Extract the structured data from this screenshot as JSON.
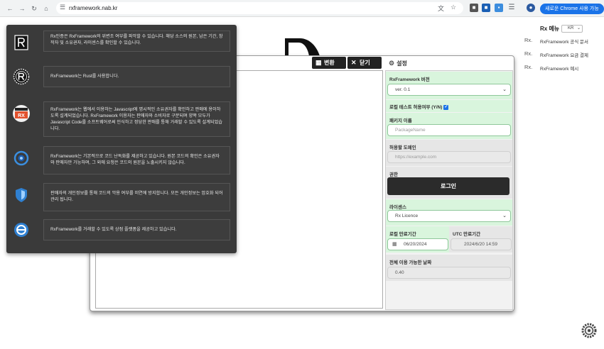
{
  "browser": {
    "url": "rxframework.nab.kr",
    "update_button": "새로운 Chrome 사용 가능",
    "nav_icons": [
      "back-arrow-icon",
      "forward-arrow-icon",
      "reload-icon",
      "home-icon"
    ]
  },
  "header": {
    "menu_title": "Rx 메뉴",
    "language": "KR",
    "links": [
      {
        "prefix": "Rx.",
        "label": "RxFramework 공식 문서"
      },
      {
        "prefix": "Rx.",
        "label": "RxFramework 요금 결제"
      },
      {
        "prefix": "Rx.",
        "label": "RxFramework 예시"
      }
    ]
  },
  "toolbar": {
    "convert_label": "변환",
    "close_label": "닫기",
    "settings_label": "설정"
  },
  "settings": {
    "version": {
      "label": "RxFramework 버전",
      "value": "ver. 0.1"
    },
    "local_test": {
      "label": "로컬 테스트 허용여부 (Y/N)",
      "checked": true
    },
    "package": {
      "label": "패키지 이름",
      "placeholder": "PackageName"
    },
    "domain": {
      "label": "허용할 도메인",
      "placeholder": "https://example.com"
    },
    "auth": {
      "label": "권한",
      "button": "로그인"
    },
    "license": {
      "label": "라이센스",
      "value": "Rx Licence"
    },
    "local_expire": {
      "label": "로컬 만료기간",
      "value": "06/20/2024"
    },
    "utc_expire": {
      "label": "UTC 만료기간",
      "value": "2024/6/20 14:59"
    },
    "days_left": {
      "label": "전체 이용 가능한 날짜",
      "value": "0.40"
    }
  },
  "overlay": {
    "items": [
      {
        "icon": "rx-logo-icon",
        "text": "Rx인증은 RxFramework의 위변조 여부를 파악할 수 있습니다. 해당 소스의 원본, 남은 기간, 창작자 및 소유권자, 라이센스를 확인할 수 있습니다."
      },
      {
        "icon": "rust-logo-icon",
        "text": "RxFramework는 Rust를 사용합니다."
      },
      {
        "icon": "rx-js-badge-icon",
        "text": "RxFramework는 웹에서 이용하는 Javascript에 명시적인 소유권자를 확인하고 판매에 용이하도록 설계되었습니다. RxFramework 이용자는 판매자와 소비자로 구분되며 양쪽 모두가 Javascript Code를 소프트웨어로써 인식하고 정당한 판매를 통해 거래할 수 있도록 설계되었습니다."
      },
      {
        "icon": "obfuscation-icon",
        "text": "RxFramework는 기본적으로 코드 난독화를 제공하고 있습니다. 원본 코드의 확인은 소유권자와 판매자만 가능하며, 그 외에 요청은 코드의 원본을 노출시키지 않습니다."
      },
      {
        "icon": "shield-icon",
        "text": "판매자의 개인정보를 통해 코드의 악용 여부를 미연에 방지합니다. 모든 개인정보는 암호화 되어 관리 됩니다."
      },
      {
        "icon": "marketplace-icon",
        "text": "RxFramework를 거래할 수 있도록 상점 플랫폼을 제공하고 있습니다."
      }
    ]
  }
}
